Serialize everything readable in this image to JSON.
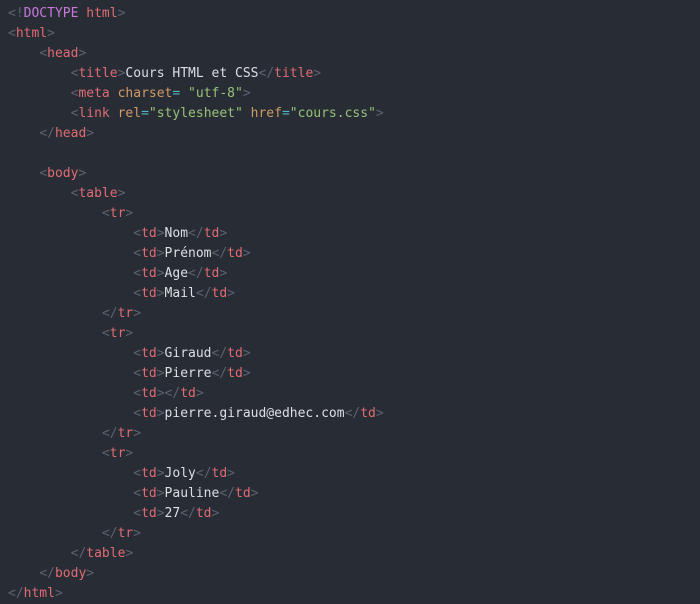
{
  "doctype": {
    "open": "<!",
    "kw": "DOCTYPE",
    "sp": " ",
    "name": "html",
    "close": ">"
  },
  "html": {
    "open": "<",
    "name": "html",
    "close": ">",
    "slash": "/"
  },
  "head": {
    "open": "<",
    "name": "head",
    "close": ">",
    "slash": "/"
  },
  "title": {
    "open": "<",
    "name": "title",
    "close": ">",
    "slash": "/",
    "text": "Cours HTML et CSS"
  },
  "meta": {
    "open": "<",
    "name": "meta",
    "close": ">",
    "attr1": "charset",
    "eq": "=",
    "sp": " ",
    "val1": "\"utf-8\""
  },
  "link": {
    "open": "<",
    "name": "link",
    "close": ">",
    "attr1": "rel",
    "eq": "=",
    "val1": "\"stylesheet\"",
    "attr2": "href",
    "val2": "\"cours.css\""
  },
  "body": {
    "open": "<",
    "name": "body",
    "close": ">",
    "slash": "/"
  },
  "table": {
    "open": "<",
    "name": "table",
    "close": ">",
    "slash": "/"
  },
  "tr": {
    "open": "<",
    "name": "tr",
    "close": ">",
    "slash": "/"
  },
  "td": {
    "open": "<",
    "name": "td",
    "close": ">",
    "slash": "/"
  },
  "cells": {
    "r1c1": "Nom",
    "r1c2": "Prénom",
    "r1c3": "Age",
    "r1c4": "Mail",
    "r2c1": "Giraud",
    "r2c2": "Pierre",
    "r2c3": "",
    "r2c4": "pierre.giraud@edhec.com",
    "r3c1": "Joly",
    "r3c2": "Pauline",
    "r3c3": "27"
  }
}
